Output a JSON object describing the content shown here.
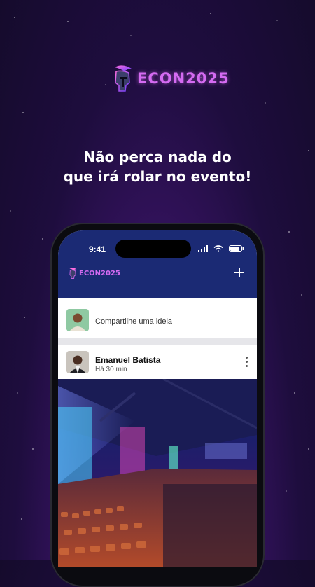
{
  "brand": {
    "name": "ECON2025",
    "accent": "#d56bf2"
  },
  "headline": {
    "line1": "Não perca nada do",
    "line2": "que irá rolar no evento!"
  },
  "phone": {
    "status_bar": {
      "time": "9:41"
    },
    "app_header": {
      "brand": "ECON2025",
      "add_icon": "plus-icon",
      "color": "#1b2a74"
    },
    "composer": {
      "placeholder": "Compartilhe uma ideia"
    },
    "post": {
      "author": "Emanuel Batista",
      "time_ago": "Há 30 min",
      "menu_icon": "more-vertical-icon",
      "image": "event-auditorium-photo"
    }
  }
}
